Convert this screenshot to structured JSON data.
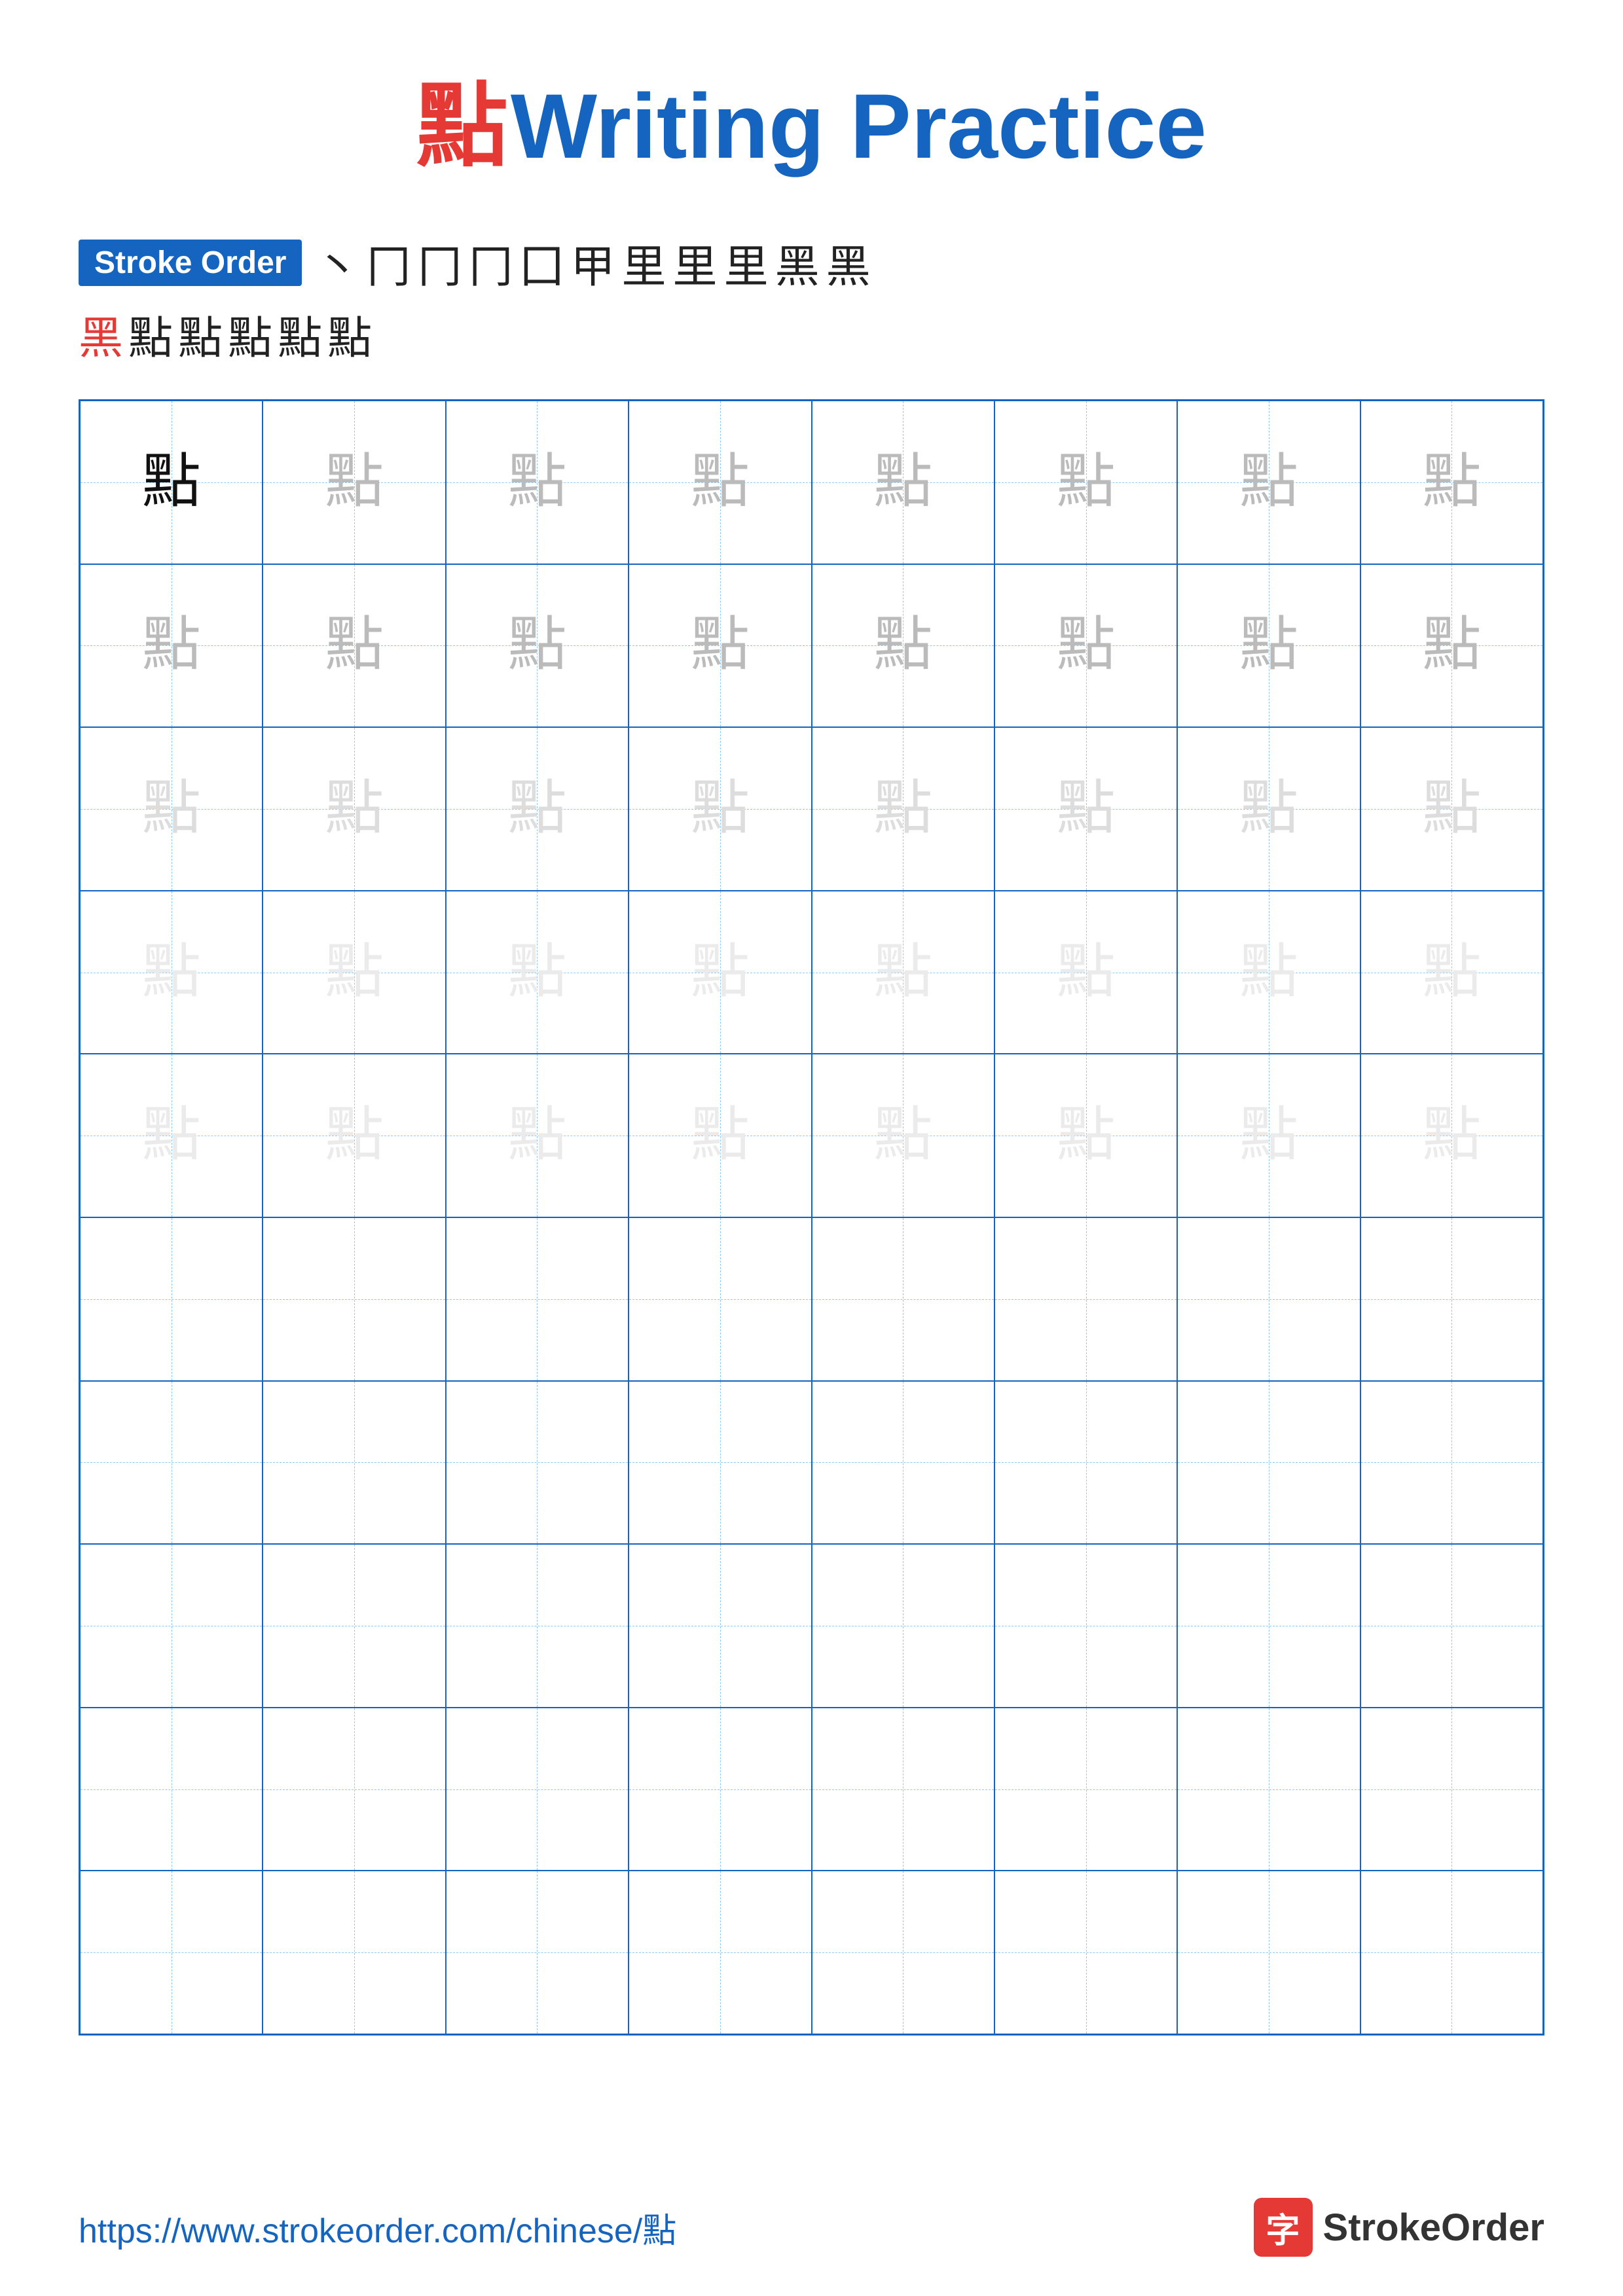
{
  "title": {
    "char": "點",
    "text": "Writing Practice"
  },
  "stroke_order": {
    "badge_label": "Stroke Order",
    "chars_row1": [
      "丶",
      "冂",
      "冂",
      "冂",
      "囗",
      "甲",
      "里",
      "里",
      "里",
      "黑",
      "黑"
    ],
    "chars_row2_prefix_red": "黑",
    "chars_row2": [
      "點",
      "點",
      "點",
      "點",
      "點"
    ]
  },
  "grid": {
    "rows": 10,
    "cols": 8,
    "character": "點",
    "row_styles": [
      "dark",
      "medium",
      "medium",
      "light",
      "light",
      "empty",
      "empty",
      "empty",
      "empty",
      "empty"
    ]
  },
  "footer": {
    "url": "https://www.strokeorder.com/chinese/點",
    "brand_char": "字",
    "brand_name": "StrokeOrder"
  }
}
